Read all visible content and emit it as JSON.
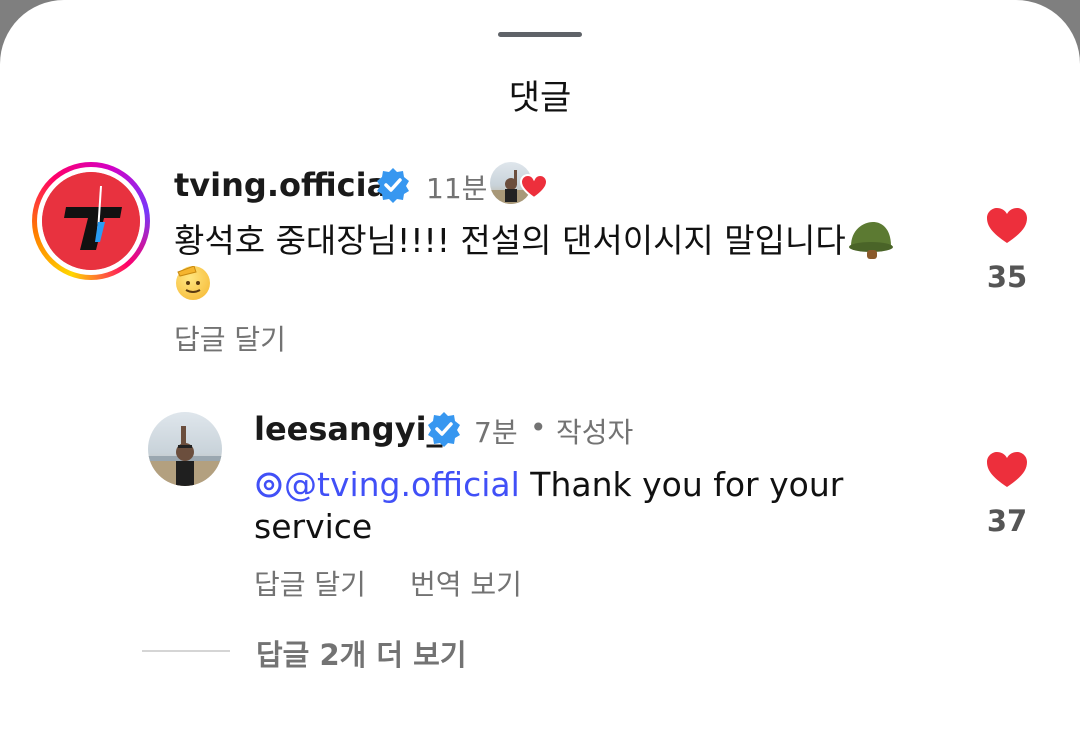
{
  "sheet": {
    "title": "댓글"
  },
  "comments": [
    {
      "username": "tving.official",
      "time": "11분",
      "text": "황석호 중대장님!!!! 전설의 댄서이시지 말입니다",
      "reply_label": "답글 달기",
      "likes": "35"
    }
  ],
  "reply": {
    "username": "leesangyi_",
    "time": "7분",
    "separator": "•",
    "author_tag": "작성자",
    "mention": "@tving.official",
    "text_line1": "Thank you for your",
    "text_line2": "service",
    "reply_label": "답글 달기",
    "translate_label": "번역 보기",
    "likes": "37"
  },
  "more_replies": "답글 2개 더 보기",
  "colors": {
    "heart": "#ed2f3c",
    "verified": "#3797f0",
    "mention": "#4150f7"
  },
  "icons": [
    "verified-badge-icon",
    "heart-icon",
    "threads-icon",
    "military-helmet-emoji",
    "saluting-face-emoji"
  ]
}
